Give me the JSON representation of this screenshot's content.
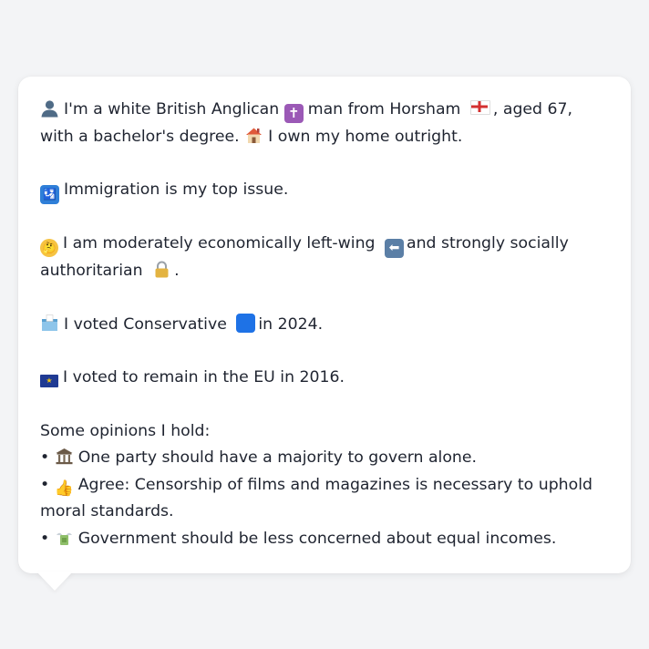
{
  "profile": {
    "intro_line": "I'm a white British Anglican",
    "intro_mid": "man from Horsham",
    "intro_tail": ", aged 67, with a bachelor's degree.",
    "home": "I own my home outright.",
    "issue": "Immigration is my top issue.",
    "ideology_a": "I am moderately economically left-wing",
    "ideology_b": "and strongly socially authoritarian",
    "ideology_end": ".",
    "vote_a": "I voted Conservative",
    "vote_b": "in 2024.",
    "eu": "I voted to remain in the EU in 2016.",
    "opinions_header": "Some opinions I hold:",
    "opinions": [
      "One party should have a majority to govern alone.",
      "Agree: Censorship of films and magazines is necessary to uphold moral standards.",
      "Government should be less concerned about equal incomes."
    ],
    "bullet": "•"
  },
  "icons": {
    "person": "person-silhouette-icon",
    "cross": "latin-cross-icon",
    "flag": "england-flag-icon",
    "house": "house-icon",
    "passport": "passport-control-icon",
    "think": "thinking-face-icon",
    "left": "left-arrow-icon",
    "lock": "lock-icon",
    "ballot": "ballot-box-icon",
    "blue": "blue-square-icon",
    "eu": "eu-flag-icon",
    "bank": "classical-building-icon",
    "thumb": "thumbs-up-icon",
    "money": "money-with-wings-icon"
  },
  "colors": {
    "background": "#f3f4f6",
    "bubble": "#ffffff",
    "text": "#1f2430",
    "conservative_blue": "#1e72e6"
  }
}
